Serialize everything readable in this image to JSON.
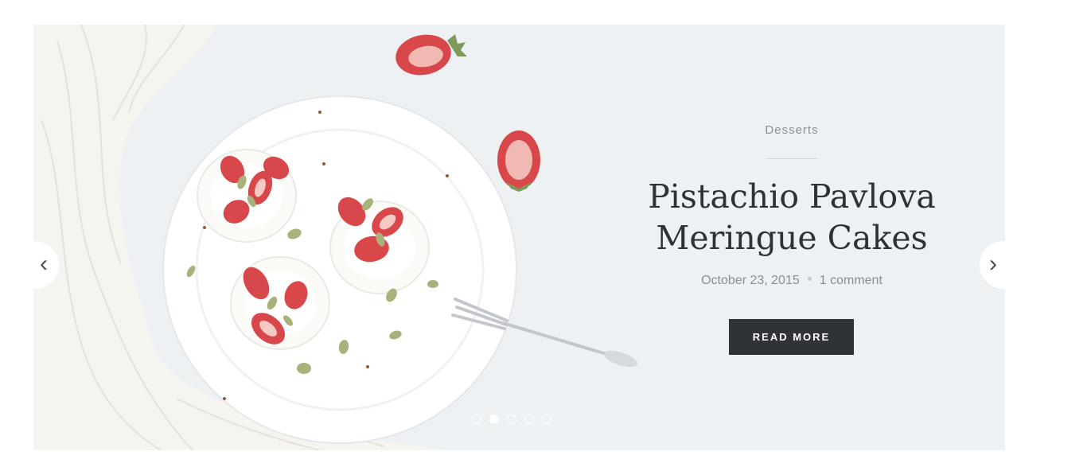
{
  "slide": {
    "category": "Desserts",
    "title_line1": "Pistachio Pavlova",
    "title_line2": "Meringue Cakes",
    "date": "October 23, 2015",
    "comments": "1 comment",
    "button_label": "READ MORE"
  },
  "navigation": {
    "prev_icon": "‹",
    "next_icon": "›"
  },
  "pagination": {
    "count": 5,
    "active_index": 1
  },
  "colors": {
    "background": "#eef1f4",
    "button": "#2f3237",
    "title": "#2e3136",
    "muted": "#8a8f96",
    "strawberry": "#d8474a"
  }
}
